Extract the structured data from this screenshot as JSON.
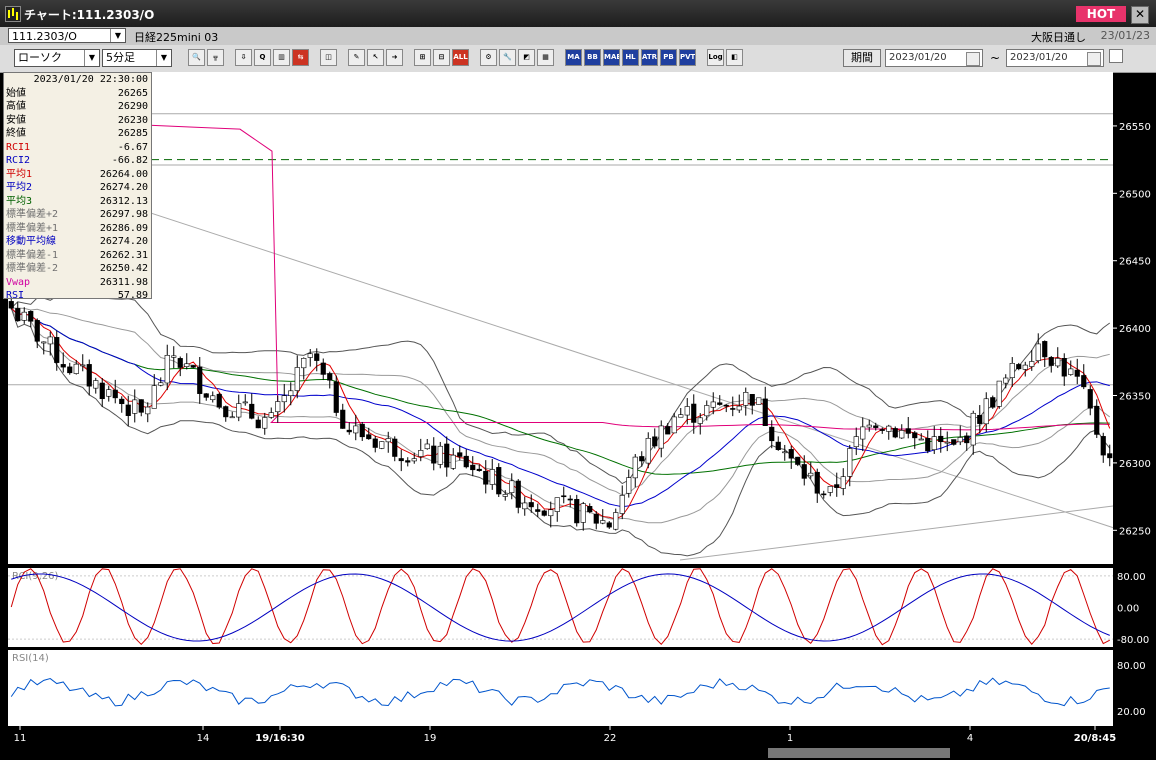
{
  "window": {
    "title": "チャート:111.2303/O",
    "hot_label": "HOT",
    "close_glyph": "✕"
  },
  "symbol_bar": {
    "symbol": "111.2303/O",
    "instrument": "日経225mini 03",
    "venue": "大阪日通し",
    "venue_date": "23/01/23"
  },
  "toolbar": {
    "chart_type": "ローソク",
    "interval": "5分足",
    "period_label": "期間",
    "date_from": "2023/01/20",
    "date_to": "2023/01/20",
    "tilde": "~",
    "buttons": [
      {
        "name": "zoom-icon",
        "glyph": "🔍",
        "style": ""
      },
      {
        "name": "split-icon",
        "glyph": "╦",
        "style": ""
      },
      {
        "name": "download-icon",
        "glyph": "⇩",
        "style": ""
      },
      {
        "name": "magnify-chart-icon",
        "glyph": "Q",
        "style": ""
      },
      {
        "name": "bar-chart-icon",
        "glyph": "▥",
        "style": ""
      },
      {
        "name": "trend-icon",
        "glyph": "⇆",
        "style": "red"
      },
      {
        "name": "disabled-icon",
        "glyph": "◫",
        "style": ""
      },
      {
        "name": "pencil-icon",
        "glyph": "✎",
        "style": ""
      },
      {
        "name": "cursor-icon",
        "glyph": "↖",
        "style": ""
      },
      {
        "name": "arrow-icon",
        "glyph": "➜",
        "style": ""
      },
      {
        "name": "candle-icon",
        "glyph": "⊞",
        "style": ""
      },
      {
        "name": "candle-pair-icon",
        "glyph": "⊟",
        "style": ""
      },
      {
        "name": "all-icon",
        "glyph": "ALL",
        "style": "red"
      },
      {
        "name": "gear-icon",
        "glyph": "⚙",
        "style": ""
      },
      {
        "name": "wrench-icon",
        "glyph": "🔧",
        "style": ""
      },
      {
        "name": "palette-icon",
        "glyph": "◩",
        "style": ""
      },
      {
        "name": "grid-icon",
        "glyph": "▦",
        "style": ""
      },
      {
        "name": "ma-icon",
        "glyph": "MA",
        "style": "blue"
      },
      {
        "name": "bb-icon",
        "glyph": "BB",
        "style": "blue"
      },
      {
        "name": "mae-icon",
        "glyph": "MAE",
        "style": "blue"
      },
      {
        "name": "hl-icon",
        "glyph": "HL",
        "style": "blue"
      },
      {
        "name": "atr-icon",
        "glyph": "ATR",
        "style": "blue"
      },
      {
        "name": "pb-icon",
        "glyph": "PB",
        "style": "blue"
      },
      {
        "name": "pvt-icon",
        "glyph": "PVT",
        "style": "blue"
      },
      {
        "name": "log-icon",
        "glyph": "Log",
        "style": ""
      },
      {
        "name": "save-chart-icon",
        "glyph": "◧",
        "style": ""
      }
    ]
  },
  "info_panel": {
    "timestamp": "2023/01/20  22:30:00",
    "rows": [
      {
        "label": "始値",
        "value": "26265",
        "color": "#000000"
      },
      {
        "label": "高値",
        "value": "26290",
        "color": "#000000"
      },
      {
        "label": "安値",
        "value": "26230",
        "color": "#000000"
      },
      {
        "label": "終値",
        "value": "26285",
        "color": "#000000"
      },
      {
        "label": "RCI1",
        "value": "-6.67",
        "color": "#d00000"
      },
      {
        "label": "RCI2",
        "value": "-66.82",
        "color": "#0000c0"
      },
      {
        "label": "平均1",
        "value": "26264.00",
        "color": "#d00000"
      },
      {
        "label": "平均2",
        "value": "26274.20",
        "color": "#0000c0"
      },
      {
        "label": "平均3",
        "value": "26312.13",
        "color": "#006000"
      },
      {
        "label": "標準偏差+2",
        "value": "26297.98",
        "color": "#707070"
      },
      {
        "label": "標準偏差+1",
        "value": "26286.09",
        "color": "#707070"
      },
      {
        "label": "移動平均線",
        "value": "26274.20",
        "color": "#0000c0"
      },
      {
        "label": "標準偏差-1",
        "value": "26262.31",
        "color": "#707070"
      },
      {
        "label": "標準偏差-2",
        "value": "26250.42",
        "color": "#707070"
      },
      {
        "label": "Vwap",
        "value": "26311.98",
        "color": "#d000a0"
      },
      {
        "label": "RSI",
        "value": "57.89",
        "color": "#0000c0"
      }
    ]
  },
  "main_chart": {
    "price_axis": [
      "26550",
      "26500",
      "26450",
      "26400",
      "26350",
      "26300",
      "26250"
    ],
    "ylim": [
      26225,
      26590
    ],
    "dashed_level": 26525,
    "horizontal_lines": [
      26521,
      26559,
      26358
    ],
    "candles_count": 170
  },
  "rci_panel": {
    "label": "RCI(9,26)",
    "axis": [
      "80.00",
      "0.00",
      "-80.00"
    ],
    "ylim": [
      -100,
      100
    ]
  },
  "rsi_panel": {
    "label": "RSI(14)",
    "axis": [
      "80.00",
      "20.00"
    ],
    "ylim": [
      0,
      100
    ]
  },
  "time_axis": {
    "labels": [
      "11",
      "14",
      "19/16:30",
      "19",
      "22",
      "1",
      "4",
      "20/8:45"
    ]
  },
  "colors": {
    "candle": "#000000",
    "ma_red": "#e00000",
    "ma_blue": "#0000cc",
    "ma_green": "#007000",
    "vwap": "#e0007a",
    "bollinger": "#555555",
    "dashed": "#006600"
  }
}
